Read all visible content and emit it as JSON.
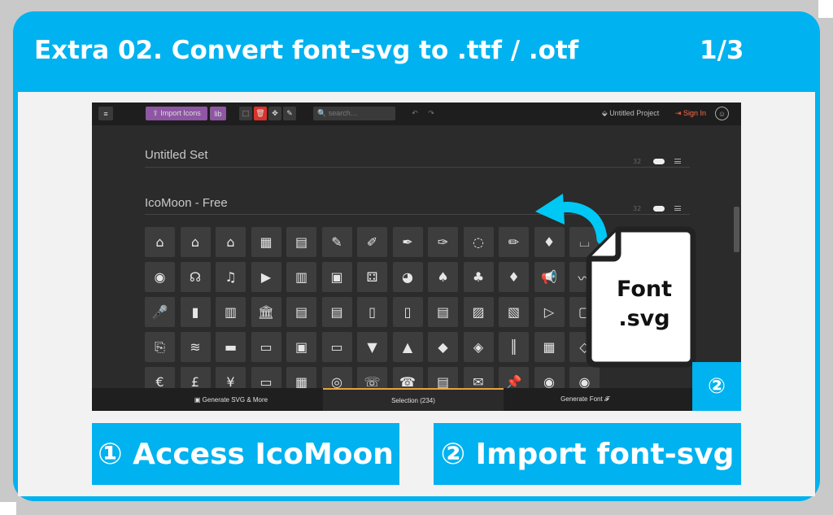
{
  "header": {
    "title": "Extra 02. Convert font-svg to .ttf / .otf",
    "page": "1/3"
  },
  "app": {
    "topbar": {
      "menu_icon": "≡",
      "import_label": "⇪ Import Icons",
      "lib_label": "lib",
      "tools": [
        "⬚",
        "🗑",
        "✥",
        "✎"
      ],
      "search_placeholder": "🔍 search…",
      "undo": "↶",
      "redo": "↷",
      "project": "⬙ Untitled Project",
      "signin": "⇥ Sign In",
      "smiley": "☺"
    },
    "sets": [
      {
        "title": "Untitled Set",
        "size": "32"
      },
      {
        "title": "IcoMoon - Free",
        "size": "32"
      }
    ],
    "icons": [
      [
        "⌂",
        "⌂",
        "⌂",
        "▦",
        "▤",
        "✎",
        "✐",
        "✒",
        "✑",
        "◌",
        "✏",
        "♦",
        "⌴"
      ],
      [
        "◉",
        "☊",
        "♫",
        "▶",
        "▥",
        "▣",
        "⚃",
        "◕",
        "♠",
        "♣",
        "♦",
        "📢",
        "〰"
      ],
      [
        "🎤",
        "▮",
        "▥",
        "🏛",
        "▤",
        "▤",
        "▯",
        "▯",
        "▤",
        "▨",
        "▧",
        "▷",
        "▢"
      ],
      [
        "⎘",
        "≋",
        "▬",
        "▭",
        "▣",
        "▭",
        "▼",
        "▲",
        "◆",
        "◈",
        "║",
        "▦",
        "◇"
      ],
      [
        "€",
        "£",
        "¥",
        "▭",
        "▦",
        "◎",
        "☏",
        "☎",
        "▤",
        "✉",
        "📌",
        "◉",
        "◉"
      ]
    ],
    "bottombar": {
      "generate_svg": "▣ Generate SVG & More",
      "selection": "Selection (234)",
      "generate_font": "Generate Font 𝓕"
    }
  },
  "overlay": {
    "file_line1": "Font",
    "file_line2": ".svg",
    "step_badge": "②"
  },
  "steps": {
    "step1": "① Access IcoMoon",
    "step2": "② Import font-svg"
  },
  "colors": {
    "accent": "#00b2ef",
    "purple": "#8e56a3",
    "red": "#d9342b"
  }
}
